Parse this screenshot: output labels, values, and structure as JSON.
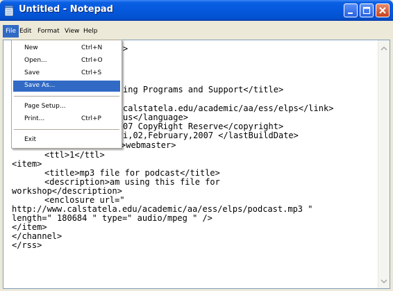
{
  "window": {
    "title": "Untitled - Notepad"
  },
  "menubar": {
    "items": [
      "File",
      "Edit",
      "Format",
      "View",
      "Help"
    ]
  },
  "file_menu": {
    "items": [
      {
        "label": "New",
        "shortcut": "Ctrl+N"
      },
      {
        "label": "Open...",
        "shortcut": "Ctrl+O"
      },
      {
        "label": "Save",
        "shortcut": "Ctrl+S"
      },
      {
        "label": "Save As...",
        "shortcut": ""
      },
      {
        "label": "Page Setup...",
        "shortcut": ""
      },
      {
        "label": "Print...",
        "shortcut": "Ctrl+P"
      },
      {
        "label": "Exit",
        "shortcut": ""
      }
    ],
    "highlighted": "Save As..."
  },
  "editor": {
    "lines": [
      ">",
      "",
      "",
      "ing Programs and Support</title>",
      "",
      "calstatela.edu/academic/aa/ess/elps</link>",
      "us</language>",
      "07 CopyRight Reserve</copyright>",
      "i,02,February,2007 </lastBuildDate>",
      ">webmaster>",
      "<ttl>1</ttl>",
      "<item>",
      "<title>mp3 file for podcast</title>",
      "<description>am using this file for",
      "workshop</description>",
      "<enclosure url=\"",
      "http://www.calstatela.edu/academic/aa/ess/elps/podcast.mp3 \"",
      "length=\" 180684 \" type=\" audio/mpeg \" />",
      "</item>",
      "</channel>",
      "</rss>"
    ]
  },
  "colors": {
    "titlebar": "#0558dc",
    "menu_highlight": "#316ac5",
    "close_button": "#c8421c"
  }
}
